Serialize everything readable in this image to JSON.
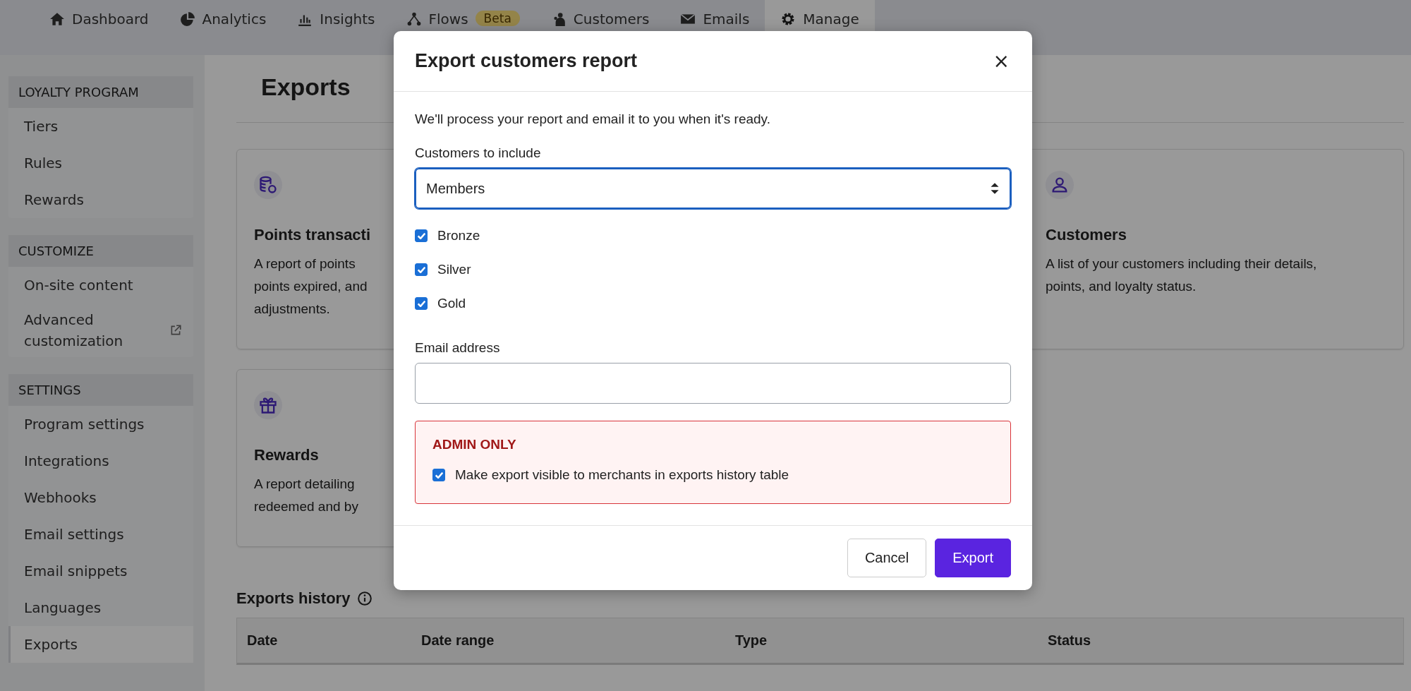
{
  "nav": {
    "tabs": [
      {
        "label": "Dashboard",
        "selected": false
      },
      {
        "label": "Analytics",
        "selected": false
      },
      {
        "label": "Insights",
        "selected": false
      },
      {
        "label": "Flows",
        "selected": false,
        "badge": "Beta"
      },
      {
        "label": "Customers",
        "selected": false
      },
      {
        "label": "Emails",
        "selected": false
      },
      {
        "label": "Manage",
        "selected": true
      }
    ]
  },
  "sidebar": {
    "groups": [
      {
        "title": "LOYALTY PROGRAM",
        "items": [
          {
            "label": "Tiers",
            "selected": false
          },
          {
            "label": "Rules",
            "selected": false
          },
          {
            "label": "Rewards",
            "selected": false
          }
        ]
      },
      {
        "title": "CUSTOMIZE",
        "items": [
          {
            "label": "On-site content",
            "selected": false
          },
          {
            "label": "Advanced customization",
            "selected": false,
            "external": true
          }
        ]
      },
      {
        "title": "SETTINGS",
        "items": [
          {
            "label": "Program settings",
            "selected": false
          },
          {
            "label": "Integrations",
            "selected": false
          },
          {
            "label": "Webhooks",
            "selected": false
          },
          {
            "label": "Email settings",
            "selected": false
          },
          {
            "label": "Email snippets",
            "selected": false
          },
          {
            "label": "Languages",
            "selected": false
          },
          {
            "label": "Exports",
            "selected": true
          }
        ]
      }
    ]
  },
  "page": {
    "title": "Exports",
    "cards": [
      {
        "title": "Points transacti",
        "description_lines": [
          "A report of points",
          "points expired, and",
          "adjustments."
        ]
      },
      {
        "title": "Customers",
        "description_lines": [
          "A list of your customers including their details,",
          "points, and loyalty status."
        ]
      },
      {
        "title": "Rewards",
        "description_lines": [
          "A report detailing",
          "redeemed and by"
        ]
      }
    ],
    "history": {
      "title": "Exports history",
      "columns": [
        "Date",
        "Date range",
        "Type",
        "Status"
      ]
    }
  },
  "modal": {
    "title": "Export customers report",
    "close": "×",
    "intro": "We'll process your report and email it to you when it's ready.",
    "include_label": "Customers to include",
    "include_value": "Members",
    "tiers": [
      {
        "label": "Bronze",
        "checked": true
      },
      {
        "label": "Silver",
        "checked": true
      },
      {
        "label": "Gold",
        "checked": true
      }
    ],
    "email_label": "Email address",
    "admin": {
      "title": "ADMIN ONLY",
      "label": "Make export visible to merchants in exports history table",
      "checked": true
    },
    "buttons": [
      {
        "label": "Cancel",
        "kind": "secondary"
      },
      {
        "label": "Export",
        "kind": "primary"
      }
    ]
  }
}
